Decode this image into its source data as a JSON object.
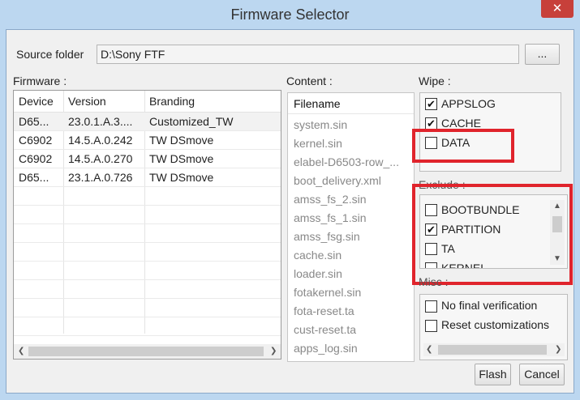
{
  "window": {
    "title": "Firmware Selector",
    "close_glyph": "✕"
  },
  "source": {
    "label": "Source folder",
    "value": "D:\\Sony FTF",
    "browse_label": "..."
  },
  "firmware": {
    "label": "Firmware :",
    "columns": [
      "Device",
      "Version",
      "Branding"
    ],
    "rows": [
      [
        "D65...",
        "23.0.1.A.3....",
        "Customized_TW"
      ],
      [
        "C6902",
        "14.5.A.0.242",
        "TW DSmove"
      ],
      [
        "C6902",
        "14.5.A.0.270",
        "TW DSmove"
      ],
      [
        "D65...",
        "23.1.A.0.726",
        "TW DSmove"
      ]
    ]
  },
  "content": {
    "label": "Content :",
    "header": "Filename",
    "items": [
      "system.sin",
      "kernel.sin",
      "elabel-D6503-row_...",
      "boot_delivery.xml",
      "amss_fs_2.sin",
      "amss_fs_1.sin",
      "amss_fsg.sin",
      "cache.sin",
      "loader.sin",
      "fotakernel.sin",
      "fota-reset.ta",
      "cust-reset.ta",
      "apps_log.sin"
    ]
  },
  "wipe": {
    "label": "Wipe :",
    "items": [
      {
        "label": "APPSLOG",
        "checked": true
      },
      {
        "label": "CACHE",
        "checked": true
      },
      {
        "label": "DATA",
        "checked": false
      }
    ]
  },
  "exclude": {
    "label": "Exclude :",
    "items": [
      {
        "label": "BOOTBUNDLE",
        "checked": false
      },
      {
        "label": "PARTITION",
        "checked": true
      },
      {
        "label": "TA",
        "checked": false
      },
      {
        "label": "KERNEL",
        "checked": false
      }
    ]
  },
  "misc": {
    "label": "Misc :",
    "items": [
      {
        "label": "No final verification",
        "checked": false
      },
      {
        "label": "Reset customizations",
        "checked": false
      }
    ]
  },
  "actions": {
    "flash_label": "Flash",
    "cancel_label": "Cancel"
  },
  "colors": {
    "highlight": "#e0242c",
    "titlebar": "#bcd7f0",
    "close": "#c7403a"
  }
}
